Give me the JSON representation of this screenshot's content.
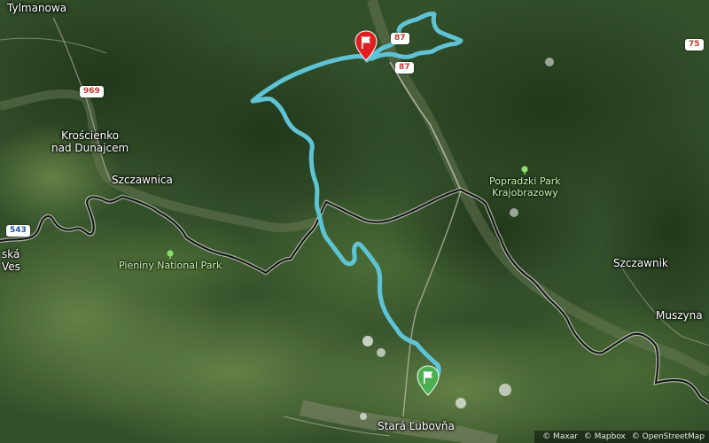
{
  "map": {
    "places": [
      {
        "id": "tylmanowa",
        "label": "Tylmanowa"
      },
      {
        "id": "kroscienko",
        "label": "Krościenko\nnad Dunajcem"
      },
      {
        "id": "szczawnica",
        "label": "Szczawnica"
      },
      {
        "id": "ska-ves",
        "label": "ská\nVes"
      },
      {
        "id": "szczawnik",
        "label": "Szczawnik"
      },
      {
        "id": "muszyna",
        "label": "Muszyna"
      },
      {
        "id": "stara-lubovna",
        "label": "Stará Ľubovňa"
      }
    ],
    "parks": [
      {
        "id": "pieniny",
        "label": "Pieniny National Park"
      },
      {
        "id": "popradzki",
        "label": "Popradzki Park\nKrajobrazowy"
      }
    ],
    "road_shields": [
      {
        "id": "r969",
        "label": "969",
        "color": "red"
      },
      {
        "id": "r543",
        "label": "543",
        "color": "blue"
      },
      {
        "id": "r75",
        "label": "75",
        "color": "red"
      },
      {
        "id": "r87a",
        "label": "87",
        "color": "red"
      },
      {
        "id": "r87b",
        "label": "87",
        "color": "red"
      }
    ],
    "route": {
      "color": "#5fc3d6",
      "start_flag_color": "#4caf50",
      "end_flag_color": "#e02020"
    },
    "border_color": "#111111"
  },
  "attribution": {
    "items": [
      "© Maxar",
      "© Mapbox",
      "© OpenStreetMap"
    ]
  }
}
